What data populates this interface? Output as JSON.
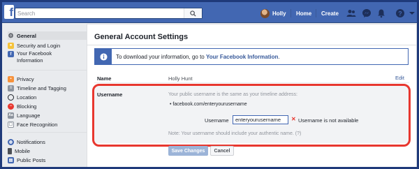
{
  "topbar": {
    "logo": "f",
    "search_placeholder": "Search",
    "profile_name": "Holly",
    "home_label": "Home",
    "create_label": "Create"
  },
  "sidebar": {
    "items": [
      {
        "label": "General",
        "icon": "gear-icon",
        "color": "#4b4f56",
        "active": true
      },
      {
        "label": "Security and Login",
        "icon": "shield-icon",
        "color": "#f5c33b"
      },
      {
        "label": "Your Facebook",
        "label2": "Information",
        "icon": "facebook-icon",
        "color": "#4267b2"
      },
      {
        "label": "Privacy",
        "icon": "privacy-icon",
        "color": "#f7923b"
      },
      {
        "label": "Timeline and Tagging",
        "icon": "timeline-icon",
        "color": "#8d949e"
      },
      {
        "label": "Location",
        "icon": "location-icon",
        "color": "#1d2129"
      },
      {
        "label": "Blocking",
        "icon": "blocking-icon",
        "color": "#e8372f"
      },
      {
        "label": "Language",
        "icon": "language-icon",
        "color": "#8d949e"
      },
      {
        "label": "Face Recognition",
        "icon": "face-recognition-icon",
        "color": "#8d949e"
      },
      {
        "label": "Notifications",
        "icon": "globe-icon",
        "color": "#4267b2"
      },
      {
        "label": "Mobile",
        "icon": "mobile-icon",
        "color": "#4b4f56"
      },
      {
        "label": "Public Posts",
        "icon": "public-posts-icon",
        "color": "#4267b2"
      }
    ]
  },
  "main": {
    "title": "General Account Settings",
    "banner_text": "To download your information, go to ",
    "banner_link": "Your Facebook Information",
    "banner_end": ".",
    "name_label": "Name",
    "name_value": "Holly Hunt",
    "edit_label": "Edit",
    "username_label": "Username",
    "username_help": "Your public username is the same as your timeline address:",
    "username_url": "facebook.com/enteryourusername",
    "field_label": "Username",
    "field_value": "enteryourusername",
    "error_text": "Username is not available",
    "note_text": "Note: Your username should include your authentic name.",
    "note_help": "(?)",
    "save_label": "Save Changes",
    "cancel_label": "Cancel"
  },
  "colors": {
    "brand": "#4267b2",
    "highlight": "#e8372f"
  }
}
